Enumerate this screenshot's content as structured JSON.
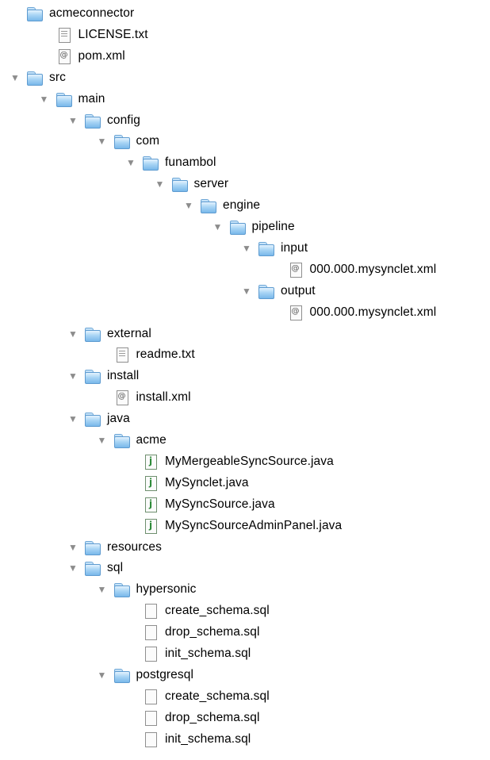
{
  "tree": [
    {
      "label": "acmeconnector",
      "type": "folder",
      "depth": 0,
      "expanded": null
    },
    {
      "label": "LICENSE.txt",
      "type": "txt",
      "depth": 1,
      "expanded": null
    },
    {
      "label": "pom.xml",
      "type": "xml",
      "depth": 1,
      "expanded": null
    },
    {
      "label": "src",
      "type": "folder",
      "depth": 0,
      "expanded": true
    },
    {
      "label": "main",
      "type": "folder",
      "depth": 1,
      "expanded": true
    },
    {
      "label": "config",
      "type": "folder",
      "depth": 2,
      "expanded": true
    },
    {
      "label": "com",
      "type": "folder",
      "depth": 3,
      "expanded": true
    },
    {
      "label": "funambol",
      "type": "folder",
      "depth": 4,
      "expanded": true
    },
    {
      "label": "server",
      "type": "folder",
      "depth": 5,
      "expanded": true
    },
    {
      "label": "engine",
      "type": "folder",
      "depth": 6,
      "expanded": true
    },
    {
      "label": "pipeline",
      "type": "folder",
      "depth": 7,
      "expanded": true
    },
    {
      "label": "input",
      "type": "folder",
      "depth": 8,
      "expanded": true
    },
    {
      "label": "000.000.mysynclet.xml",
      "type": "xml",
      "depth": 9,
      "expanded": null
    },
    {
      "label": "output",
      "type": "folder",
      "depth": 8,
      "expanded": true
    },
    {
      "label": "000.000.mysynclet.xml",
      "type": "xml",
      "depth": 9,
      "expanded": null
    },
    {
      "label": "external",
      "type": "folder",
      "depth": 2,
      "expanded": true
    },
    {
      "label": "readme.txt",
      "type": "txt",
      "depth": 3,
      "expanded": null
    },
    {
      "label": "install",
      "type": "folder",
      "depth": 2,
      "expanded": true
    },
    {
      "label": "install.xml",
      "type": "xml",
      "depth": 3,
      "expanded": null
    },
    {
      "label": "java",
      "type": "folder",
      "depth": 2,
      "expanded": true
    },
    {
      "label": "acme",
      "type": "folder",
      "depth": 3,
      "expanded": true
    },
    {
      "label": "MyMergeableSyncSource.java",
      "type": "java",
      "depth": 4,
      "expanded": null
    },
    {
      "label": "MySynclet.java",
      "type": "java",
      "depth": 4,
      "expanded": null
    },
    {
      "label": "MySyncSource.java",
      "type": "java",
      "depth": 4,
      "expanded": null
    },
    {
      "label": "MySyncSourceAdminPanel.java",
      "type": "java",
      "depth": 4,
      "expanded": null
    },
    {
      "label": "resources",
      "type": "folder",
      "depth": 2,
      "expanded": true
    },
    {
      "label": "sql",
      "type": "folder",
      "depth": 2,
      "expanded": true
    },
    {
      "label": "hypersonic",
      "type": "folder",
      "depth": 3,
      "expanded": true
    },
    {
      "label": "create_schema.sql",
      "type": "blank",
      "depth": 4,
      "expanded": null
    },
    {
      "label": "drop_schema.sql",
      "type": "blank",
      "depth": 4,
      "expanded": null
    },
    {
      "label": "init_schema.sql",
      "type": "blank",
      "depth": 4,
      "expanded": null
    },
    {
      "label": "postgresql",
      "type": "folder",
      "depth": 3,
      "expanded": true
    },
    {
      "label": "create_schema.sql",
      "type": "blank",
      "depth": 4,
      "expanded": null
    },
    {
      "label": "drop_schema.sql",
      "type": "blank",
      "depth": 4,
      "expanded": null
    },
    {
      "label": "init_schema.sql",
      "type": "blank",
      "depth": 4,
      "expanded": null
    }
  ]
}
